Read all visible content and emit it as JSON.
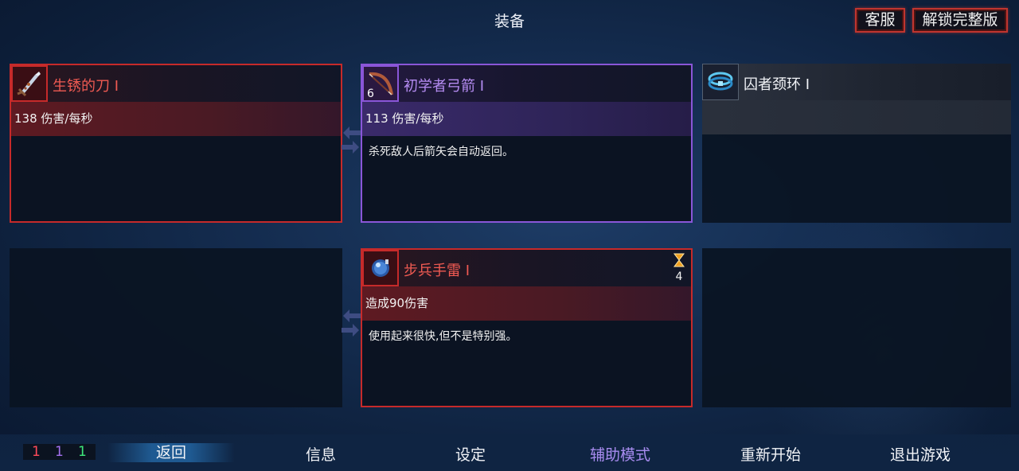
{
  "page_title": "装备",
  "top_buttons": {
    "service": "客服",
    "unlock": "解锁完整版"
  },
  "cards": {
    "melee": {
      "name": "生锈的刀 I",
      "stat": "138 伤害/每秒",
      "icon": "rusty-sword-icon",
      "border_color": "#c62a2a"
    },
    "bow": {
      "name": "初学者弓箭 I",
      "icon_count": "6",
      "stat": "113 伤害/每秒",
      "description": "杀死敌人后箭矢会自动返回。",
      "icon": "bow-icon",
      "border_color": "#8a56d8"
    },
    "amulet": {
      "name": "囚者颈环 I",
      "icon": "collar-amulet-icon"
    },
    "grenade": {
      "name": "步兵手雷 I",
      "cooldown": "4",
      "stat": "造成90伤害",
      "description": "使用起来很快,但不是特别强。",
      "icon": "grenade-icon",
      "border_color": "#c62a2a"
    }
  },
  "bottom": {
    "counters": [
      {
        "value": "1",
        "color": "#ff4a5a"
      },
      {
        "value": "1",
        "color": "#a470ee"
      },
      {
        "value": "1",
        "color": "#3ee87a"
      }
    ],
    "nav": {
      "back": "返回",
      "info": "信息",
      "settings": "设定",
      "assist": "辅助模式",
      "restart": "重新开始",
      "quit": "退出游戏"
    }
  }
}
